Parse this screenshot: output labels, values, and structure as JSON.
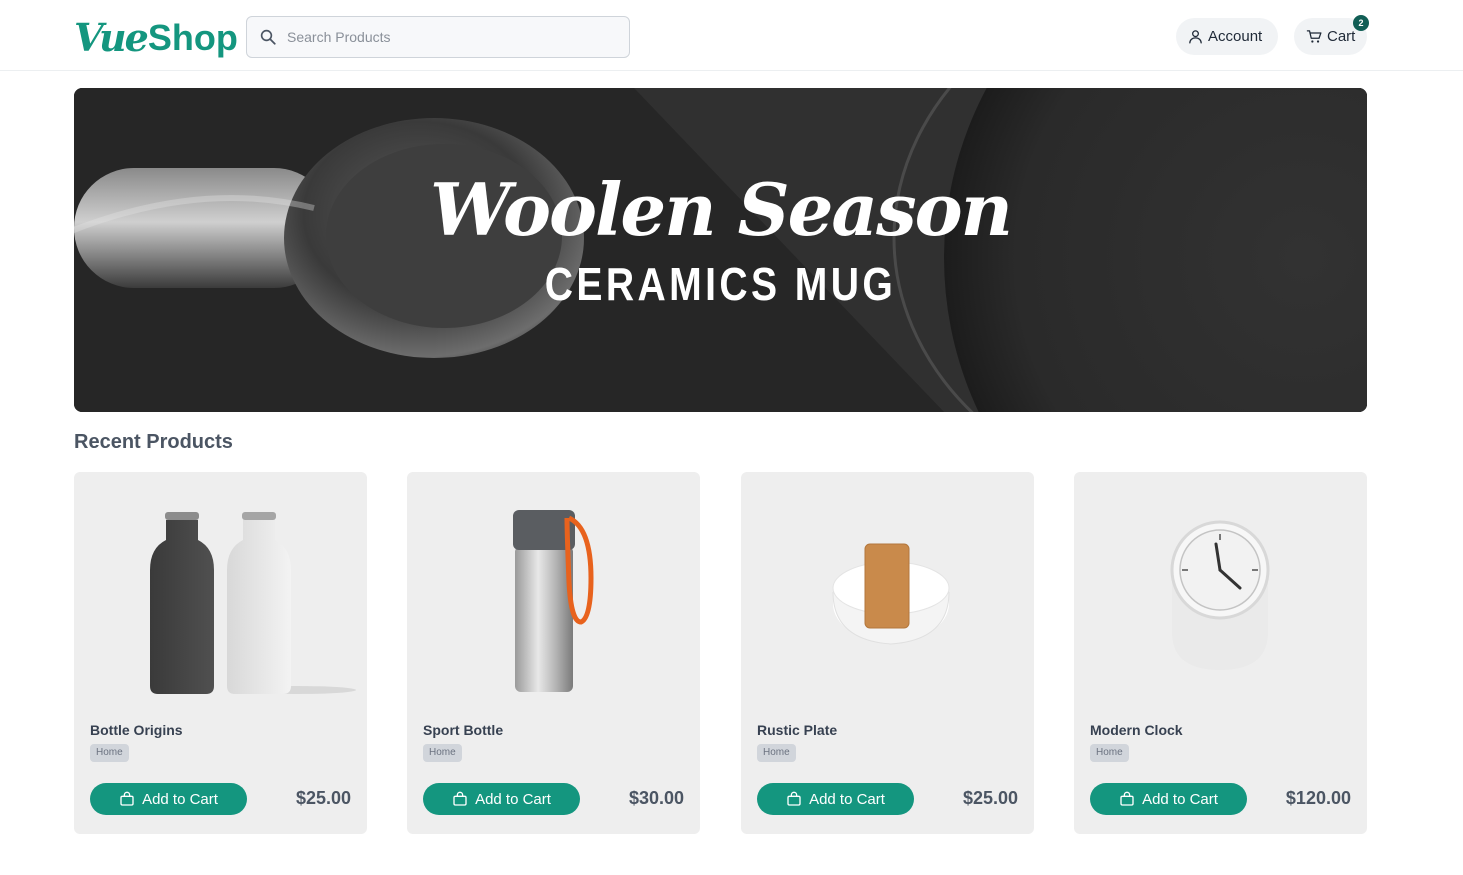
{
  "header": {
    "logo_vue": "Vue",
    "logo_shop": "Shop",
    "search_placeholder": "Search Products",
    "account_label": "Account",
    "cart_label": "Cart",
    "cart_count": "2"
  },
  "hero": {
    "title": "Woolen Season",
    "subtitle": "CERAMICS MUG"
  },
  "section": {
    "title": "Recent Products"
  },
  "products": [
    {
      "name": "Bottle Origins",
      "category": "Home",
      "button": "Add to Cart",
      "price": "$25.00"
    },
    {
      "name": "Sport Bottle",
      "category": "Home",
      "button": "Add to Cart",
      "price": "$30.00"
    },
    {
      "name": "Rustic Plate",
      "category": "Home",
      "button": "Add to Cart",
      "price": "$25.00"
    },
    {
      "name": "Modern Clock",
      "category": "Home",
      "button": "Add to Cart",
      "price": "$120.00"
    }
  ],
  "colors": {
    "brand": "#14967f",
    "badge": "#115e55",
    "card_bg": "#eeeeee"
  }
}
